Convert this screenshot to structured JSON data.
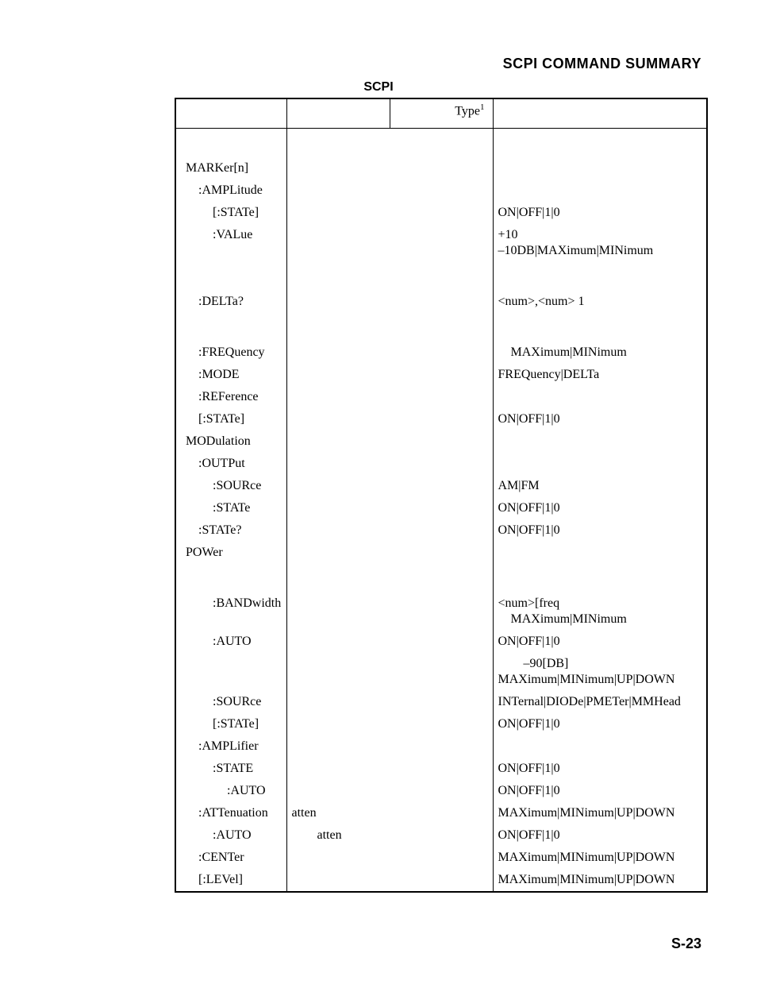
{
  "running_head": "SCPI COMMAND SUMMARY",
  "caption": "SCPI",
  "header": {
    "type": "Type",
    "type_sup": "1"
  },
  "rows": [
    {
      "cmd": "MARKer[n]",
      "indent": 0
    },
    {
      "cmd": ":AMPLitude",
      "indent": 1
    },
    {
      "cmd": "[:STATe]",
      "indent": 2,
      "param": "ON|OFF|1|0"
    },
    {
      "cmd": ":VALue",
      "indent": 2,
      "param_lines": [
        "+10",
        "–10DB|MAXimum|MINimum"
      ]
    },
    {
      "spacer": true
    },
    {
      "cmd": ":DELTa?",
      "indent": 1,
      "param": "<num>,<num> 1"
    },
    {
      "spacer": true
    },
    {
      "cmd": ":FREQuency",
      "indent": 1,
      "param_lines": [
        "",
        " MAXimum|MINimum"
      ]
    },
    {
      "cmd": ":MODE",
      "indent": 1,
      "param": "FREQuency|DELTa"
    },
    {
      "cmd": ":REFerence",
      "indent": 1
    },
    {
      "cmd": "[:STATe]",
      "indent": 1,
      "param": "ON|OFF|1|0"
    },
    {
      "cmd": "MODulation",
      "indent": 0
    },
    {
      "cmd": ":OUTPut",
      "indent": 1
    },
    {
      "cmd": ":SOURce",
      "indent": 2,
      "param": "AM|FM"
    },
    {
      "cmd": ":STATe",
      "indent": 2,
      "param": "ON|OFF|1|0"
    },
    {
      "cmd": ":STATe?",
      "indent": 1,
      "param": "ON|OFF|1|0"
    },
    {
      "cmd": "POWer",
      "indent": 0
    },
    {
      "spacer": true
    },
    {
      "cmd": ":BANDwidth",
      "indent": 2,
      "param_lines": [
        "<num>[freq",
        " MAXimum|MINimum"
      ]
    },
    {
      "cmd": ":AUTO",
      "indent": 2,
      "param": "ON|OFF|1|0"
    },
    {
      "cmd": "",
      "indent": 2,
      "param_lines": [
        "  –90[DB]",
        "MAXimum|MINimum|UP|DOWN"
      ]
    },
    {
      "cmd": ":SOURce",
      "indent": 2,
      "param": "INTernal|DIODe|PMETer|MMHead"
    },
    {
      "cmd": "[:STATe]",
      "indent": 2,
      "param": "ON|OFF|1|0"
    },
    {
      "cmd": ":AMPLifier",
      "indent": 1
    },
    {
      "cmd": ":STATE",
      "indent": 2,
      "param": "ON|OFF|1|0"
    },
    {
      "cmd": ":AUTO",
      "indent": 3,
      "param": "ON|OFF|1|0"
    },
    {
      "cmd": ":ATTenuation",
      "indent": 1,
      "col2": "atten",
      "param_lines": [
        "",
        "MAXimum|MINimum|UP|DOWN"
      ]
    },
    {
      "cmd": ":AUTO",
      "indent": 2,
      "col2": "  atten",
      "param": "ON|OFF|1|0"
    },
    {
      "cmd": ":CENTer",
      "indent": 1,
      "param_lines": [
        "",
        "MAXimum|MINimum|UP|DOWN"
      ]
    },
    {
      "cmd": "[:LEVel]",
      "indent": 1,
      "param_lines": [
        "",
        "MAXimum|MINimum|UP|DOWN"
      ]
    }
  ],
  "page_number": "S-23"
}
